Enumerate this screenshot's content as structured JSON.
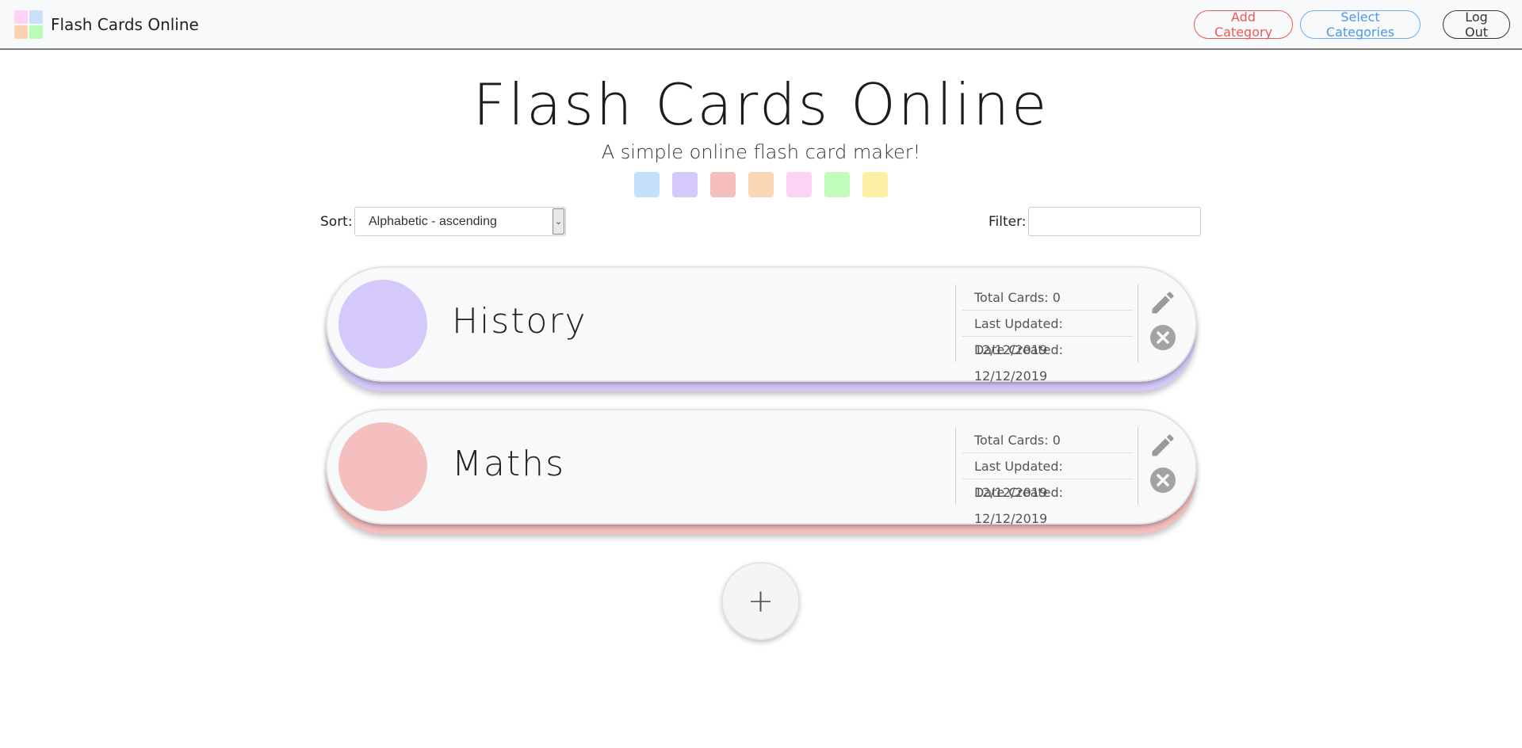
{
  "navbar": {
    "brand": "Flash Cards Online",
    "logo_colors": [
      "#ffd1f4",
      "#c8e0fb",
      "#fcd2b3",
      "#b9fcb5"
    ],
    "add_category": "Add Category",
    "select_categories": "Select Categories",
    "logout": "Log Out"
  },
  "hero": {
    "title": "Flash Cards Online",
    "subtitle": "A simple online flash card maker!",
    "swatches": [
      "#c5e0fb",
      "#d5c8fb",
      "#f6bfbf",
      "#fbd6b5",
      "#fdd3f4",
      "#c0fcba",
      "#fbf0a6"
    ]
  },
  "controls": {
    "sort_label": "Sort:",
    "sort_value": "Alphabetic - ascending",
    "filter_label": "Filter:",
    "filter_value": ""
  },
  "categories": [
    {
      "name": "History",
      "color": "#d5c8fb",
      "total_cards": "Total Cards: 0",
      "last_updated": "Last Updated: 12/12/2019",
      "date_created": "Date Created: 12/12/2019"
    },
    {
      "name": "Maths",
      "color": "#f6bfbf",
      "total_cards": "Total Cards: 0",
      "last_updated": "Last Updated: 12/12/2019",
      "date_created": "Date Created: 12/12/2019"
    }
  ],
  "add_button": "+"
}
